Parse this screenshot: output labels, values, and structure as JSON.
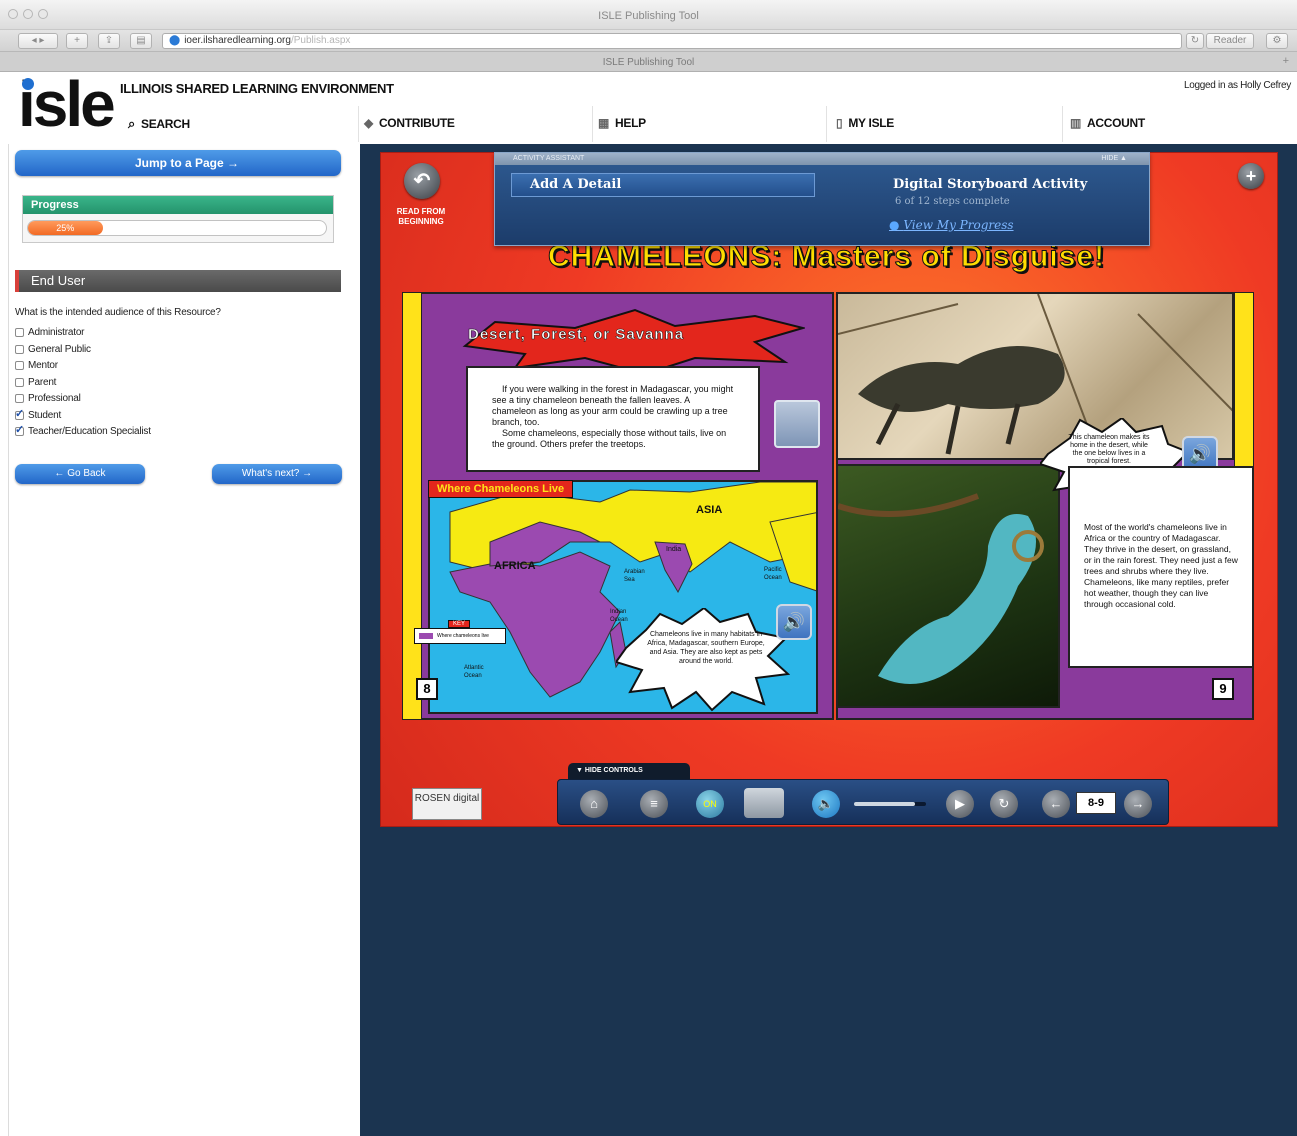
{
  "browser": {
    "window_title": "ISLE Publishing Tool",
    "url_host": "ioer.ilsharedlearning.org",
    "url_path": "/Publish.aspx",
    "tab_title": "ISLE Publishing Tool",
    "reader_label": "Reader"
  },
  "header": {
    "logo_text": "isle",
    "site_name": "ILLINOIS SHARED LEARNING ENVIRONMENT",
    "logged_in": "Logged in as Holly Cefrey",
    "menu": {
      "search": "SEARCH",
      "contribute": "CONTRIBUTE",
      "help": "HELP",
      "my_isle": "MY ISLE",
      "account": "ACCOUNT"
    }
  },
  "sidebar": {
    "jump_label": "Jump to a Page →",
    "progress_title": "Progress",
    "progress_text": "25%",
    "progress_value": 0.25,
    "section_title": "End User",
    "question": "What is the intended audience of this Resource?",
    "options": [
      {
        "label": "Administrator",
        "checked": false
      },
      {
        "label": "General Public",
        "checked": false
      },
      {
        "label": "Mentor",
        "checked": false
      },
      {
        "label": "Parent",
        "checked": false
      },
      {
        "label": "Professional",
        "checked": false
      },
      {
        "label": "Student",
        "checked": true
      },
      {
        "label": "Teacher/Education Specialist",
        "checked": true
      }
    ],
    "back_label": "← Go Back",
    "next_label": "What's next? →"
  },
  "book": {
    "title": "CHAMELEONS: Masters of Disguise!",
    "read_from_beginning": "READ FROM BEGINNING",
    "assistant": {
      "bar_label": "ACTIVITY ASSISTANT",
      "hide_label": "HIDE ▲",
      "add_detail": "Add A Detail",
      "activity_title": "Digital Storyboard Activity",
      "steps": "6 of 12 steps complete",
      "progress_link": "View My Progress"
    },
    "left_page": {
      "callout": "Desert, Forest, or Savanna",
      "body": "If you were walking in the forest in Madagascar, you might see a tiny chameleon beneath the fallen leaves. A chameleon as long as your arm could be crawling up a tree branch, too.",
      "body2": "Some chameleons, especially those without tails, live on the ground. Others prefer the treetops.",
      "map_title": "Where Chameleons Live",
      "labels": {
        "asia": "ASIA",
        "africa": "AFRICA",
        "india": "India",
        "arabian": "Arabian Sea",
        "indian": "Indian Ocean",
        "atlantic": "Atlantic Ocean",
        "pacific": "Pacific Ocean",
        "key": "KEY",
        "key_item": "Where chameleons live"
      },
      "bubble": "Chameleons live in many habitats in Africa, Madagascar, southern Europe, and Asia. They are also kept as pets around the world.",
      "page_number": "8"
    },
    "right_page": {
      "bubble": "This chameleon makes its home in the desert, while the one below lives in a tropical forest.",
      "body": "Most of the world's chameleons live in Africa or the country of Madagascar. They thrive in the desert, on grassland, or in the rain forest. They need just a few trees and shrubs where they live. Chameleons, like many reptiles, prefer hot weather, though they can live through occasional cold.",
      "page_number": "9"
    },
    "controls": {
      "hide_label": "▼ HIDE CONTROLS",
      "page_range": "8-9",
      "rosen_logo": "ROSEN digital",
      "toggle_label": "ON",
      "volume": 0.85
    }
  }
}
